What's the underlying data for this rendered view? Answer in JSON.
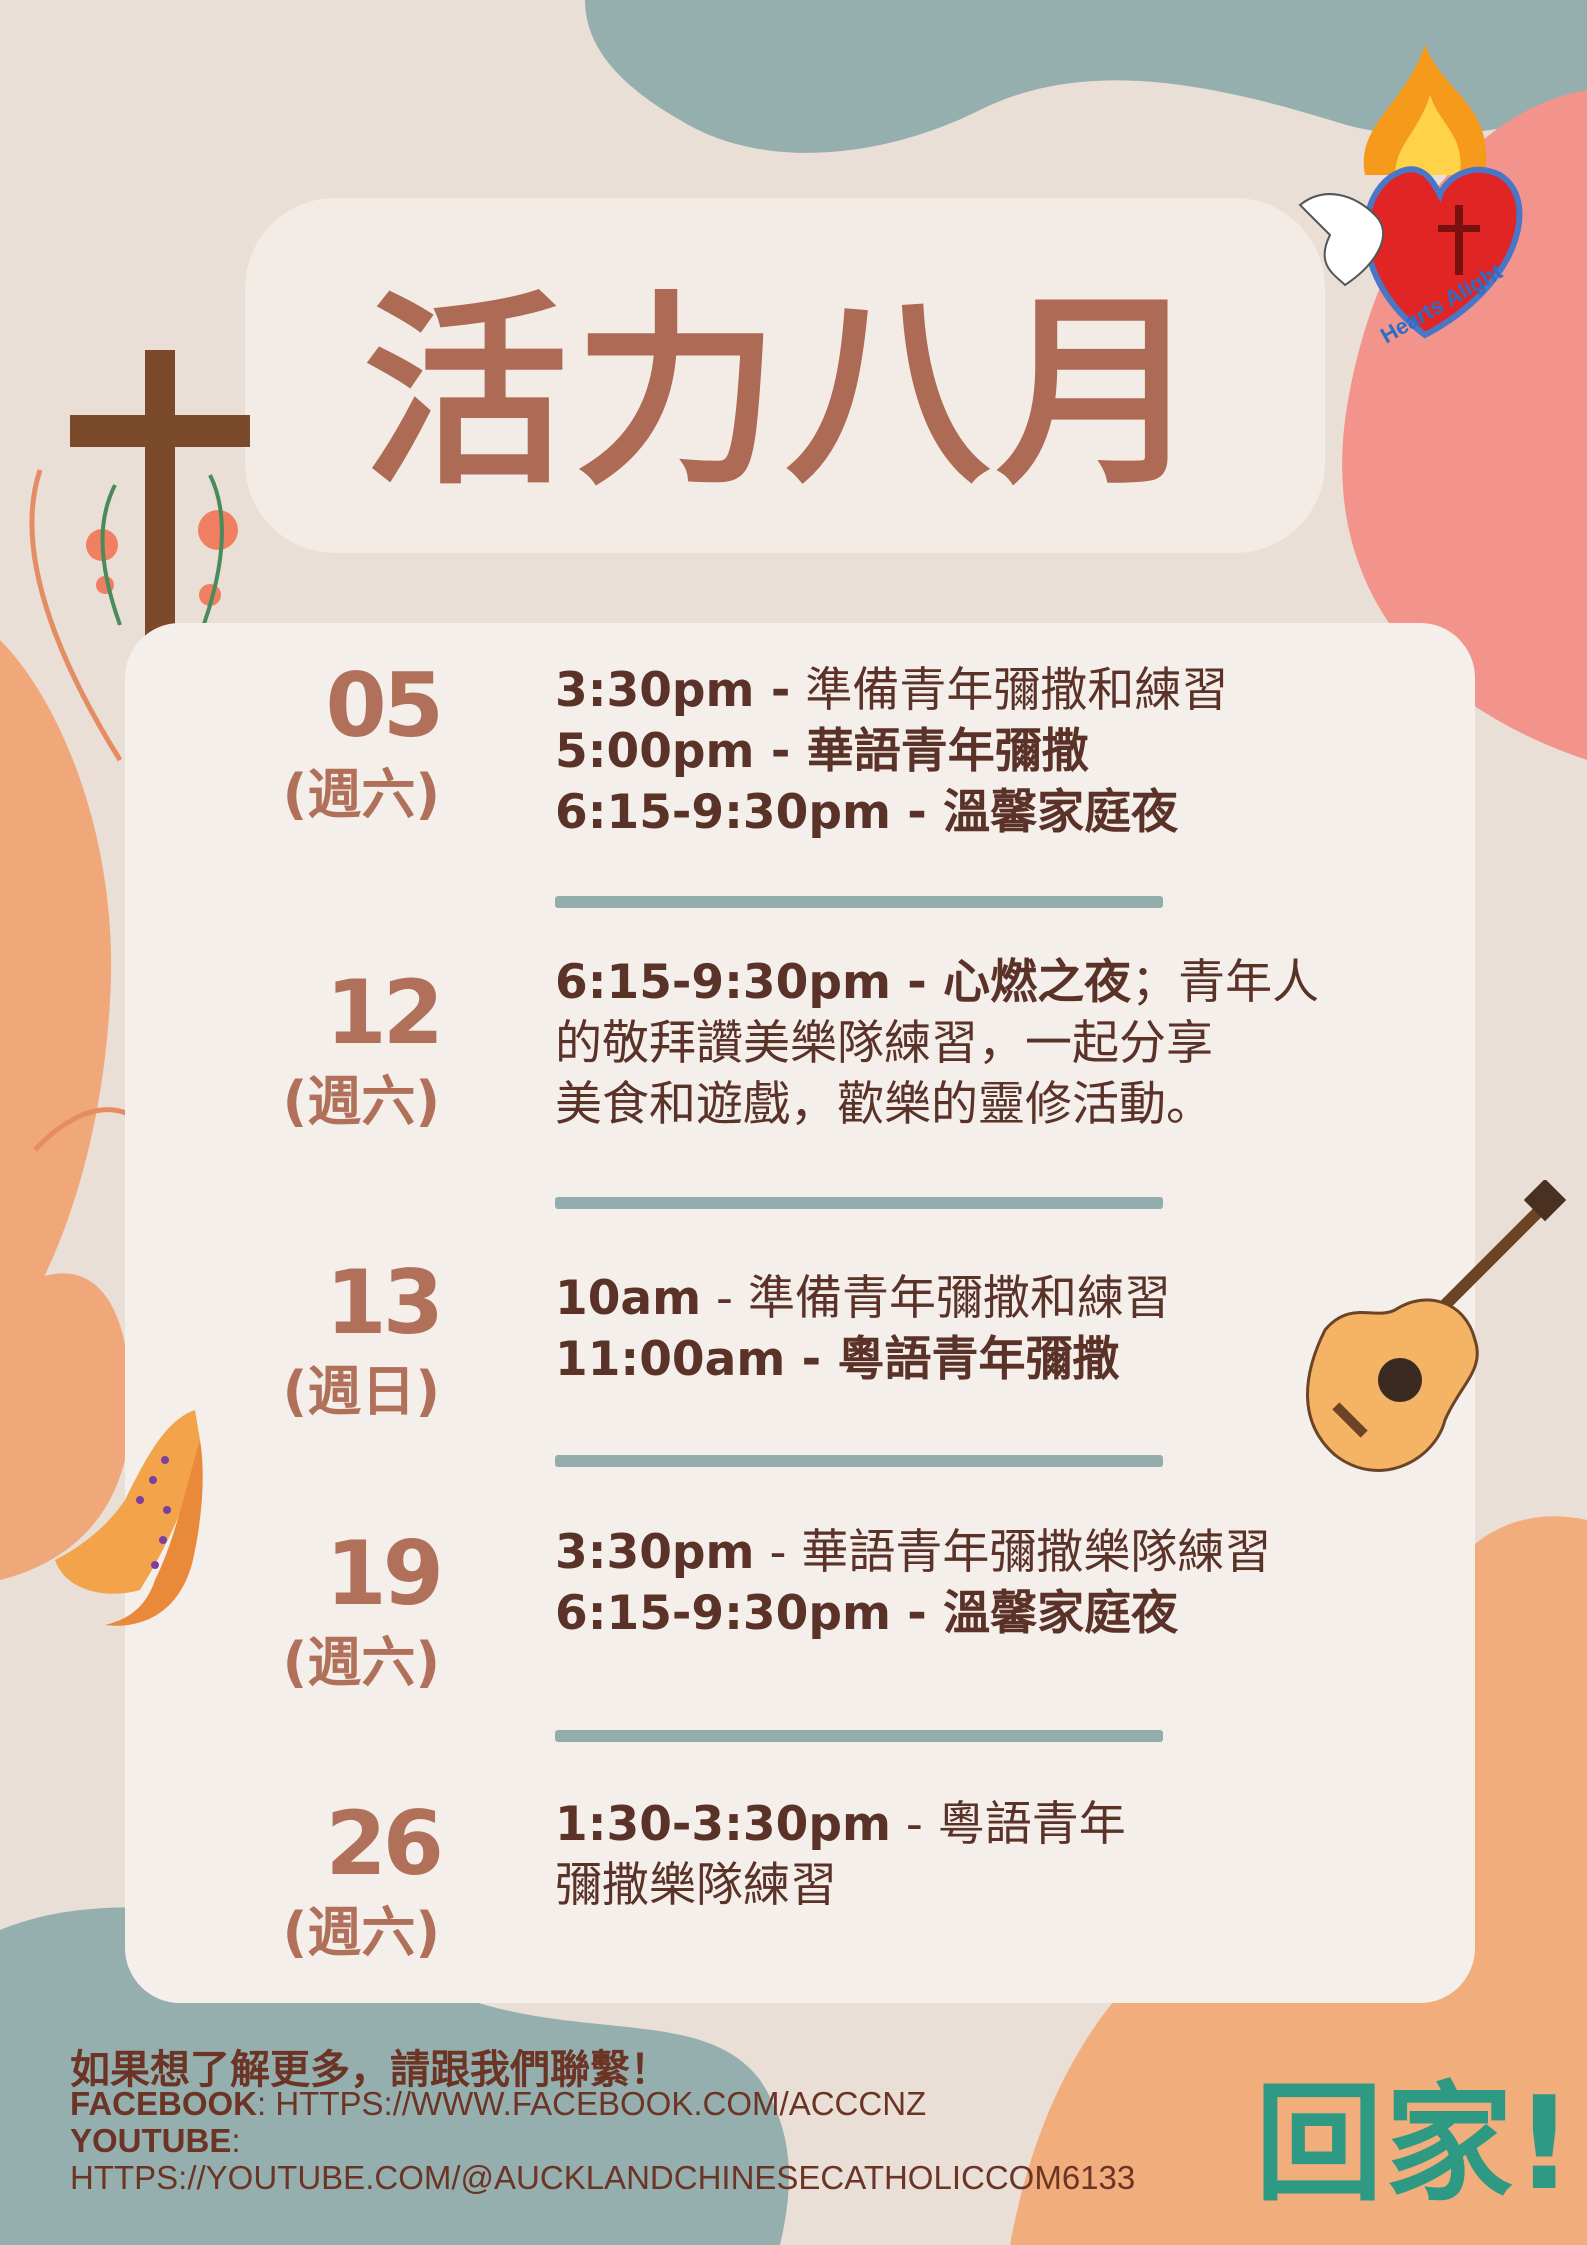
{
  "title": "活力八月",
  "logo": {
    "text": "Hearts Alight"
  },
  "schedule": [
    {
      "date": "05",
      "day": "(週六)",
      "lines": [
        {
          "time": "3:30pm -",
          "desc": " 準備青年彌撒和練習",
          "desc_bold": false
        },
        {
          "time": "5:00pm -",
          "desc": " 華語青年彌撒",
          "desc_bold": true
        },
        {
          "time": "6:15-9:30pm -",
          "desc": " 溫馨家庭夜",
          "desc_bold": true
        }
      ]
    },
    {
      "date": "12",
      "day": "(週六)",
      "lines": [
        {
          "time": "6:15-9:30pm -",
          "desc": " 心燃之夜",
          "desc_bold": true,
          "rest": "；青年人"
        },
        {
          "text": "的敬拜讚美樂隊練習，一起分享"
        },
        {
          "text": "美食和遊戲，歡樂的靈修活動。"
        }
      ]
    },
    {
      "date": "13",
      "day": "(週日)",
      "lines": [
        {
          "time": "10am",
          "desc": " - 準備青年彌撒和練習",
          "desc_bold": false
        },
        {
          "time": "11:00am -",
          "desc": " 粵語青年彌撒",
          "desc_bold": true
        }
      ]
    },
    {
      "date": "19",
      "day": "(週六)",
      "lines": [
        {
          "time": "3:30pm",
          "desc": " - 華語青年彌撒樂隊練習",
          "desc_bold": false
        },
        {
          "time": "6:15-9:30pm -",
          "desc": " 溫馨家庭夜",
          "desc_bold": true
        }
      ]
    },
    {
      "date": "26",
      "day": "(週六)",
      "lines": [
        {
          "time": "1:30-3:30pm",
          "desc": " - 粵語青年",
          "desc_bold": false
        },
        {
          "text": "彌撒樂隊練習"
        }
      ]
    }
  ],
  "footer": {
    "heading": "如果想了解更多，請跟我們聯繫！",
    "facebook_label": "FACEBOOK",
    "facebook_url": ": HTTPS://WWW.FACEBOOK.COM/ACCCNZ",
    "youtube_label": "YOUTUBE",
    "youtube_colon": ":",
    "youtube_url": "HTTPS://YOUTUBE.COM/@AUCKLANDCHINESECATHOLICCOM6133"
  },
  "home_text": "回家!",
  "colors": {
    "title": "#ad6a54",
    "text": "#5b3228",
    "accent": "#2f9a83",
    "divider": "#93acac"
  }
}
